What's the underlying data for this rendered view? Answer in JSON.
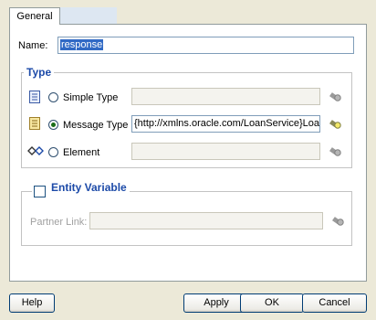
{
  "tabs": [
    {
      "label": "General",
      "active": true
    }
  ],
  "name_field": {
    "label": "Name:",
    "value": "response"
  },
  "type_group": {
    "title": "Type",
    "options": [
      {
        "label": "Simple Type",
        "selected": false,
        "value": "",
        "icon": "simple-type-icon",
        "browse_icon": "flashlight-icon"
      },
      {
        "label": "Message Type",
        "selected": true,
        "value": "{http://xmlns.oracle.com/LoanService}Loa",
        "icon": "message-type-icon",
        "browse_icon": "flashlight-icon"
      },
      {
        "label": "Element",
        "selected": false,
        "value": "",
        "icon": "element-icon",
        "browse_icon": "flashlight-icon"
      }
    ]
  },
  "entity_group": {
    "title": "Entity Variable",
    "checked": false,
    "partner_link": {
      "label": "Partner Link:",
      "value": ""
    }
  },
  "buttons": {
    "help": "Help",
    "apply": "Apply",
    "ok": "OK",
    "cancel": "Cancel"
  }
}
